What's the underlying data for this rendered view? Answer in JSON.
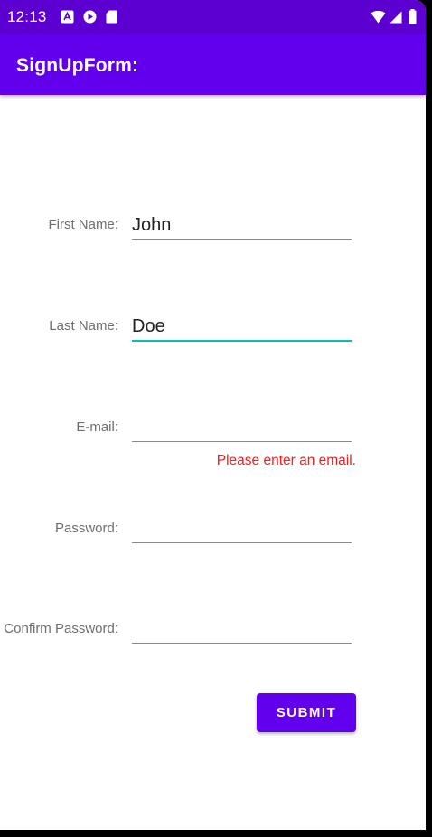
{
  "status_bar": {
    "time": "12:13",
    "bg_color": "#5c00d2",
    "left_icons": [
      "a-notification-icon",
      "play-store-icon",
      "sd-card-icon"
    ],
    "right_icons": [
      "wifi-icon",
      "cell-signal-icon",
      "battery-icon"
    ]
  },
  "app_bar": {
    "title": "SignUpForm:",
    "bg_color": "#6200ee"
  },
  "form": {
    "first_name": {
      "label": "First Name:",
      "value": "John"
    },
    "last_name": {
      "label": "Last Name:",
      "value": "Doe",
      "focused": true
    },
    "email": {
      "label": "E-mail:",
      "value": "",
      "error": "Please enter an email."
    },
    "password": {
      "label": "Password:",
      "value": ""
    },
    "confirm_password": {
      "label": "Confirm Password:",
      "value": ""
    },
    "submit_label": "SUBMIT"
  },
  "colors": {
    "accent": "#6200ee",
    "focus_underline": "#03c4b4",
    "error": "#ff1a1a"
  }
}
